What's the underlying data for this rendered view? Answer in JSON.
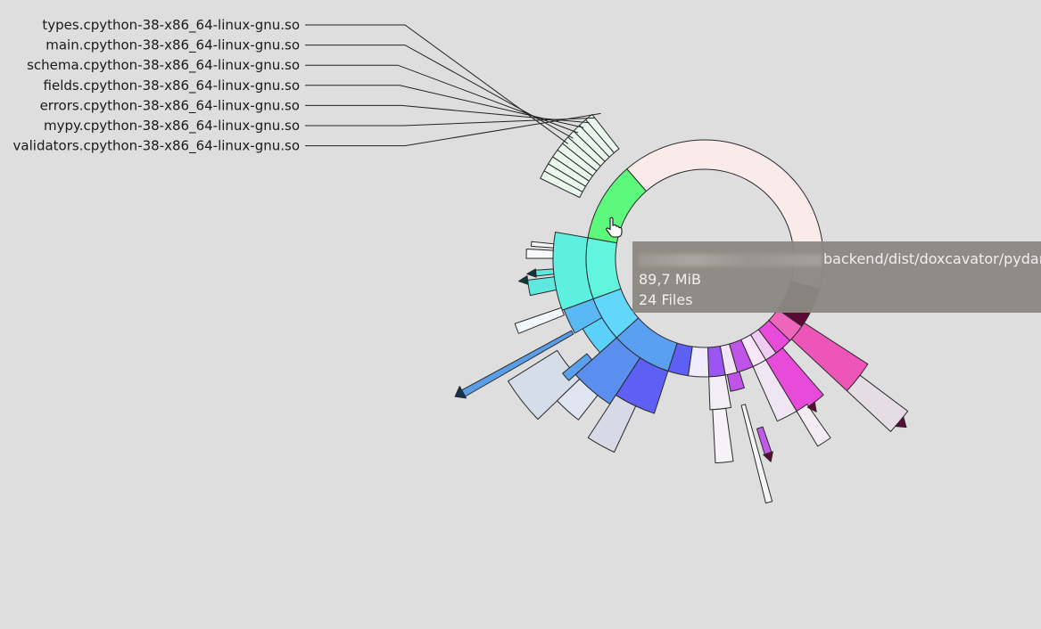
{
  "labels": [
    "types.cpython-38-x86_64-linux-gnu.so",
    "main.cpython-38-x86_64-linux-gnu.so",
    "schema.cpython-38-x86_64-linux-gnu.so",
    "fields.cpython-38-x86_64-linux-gnu.so",
    "errors.cpython-38-x86_64-linux-gnu.so",
    "mypy.cpython-38-x86_64-linux-gnu.so",
    "validators.cpython-38-x86_64-linux-gnu.so"
  ],
  "tooltip": {
    "path_visible": "backend/dist/doxcavator/pydan",
    "size": "89,7 MiB",
    "files": "24 Files"
  },
  "colors": {
    "background": "#dedede",
    "tooltip": "#8a8880",
    "root_segment": "#fbeaea",
    "highlight": "#5cf97c"
  }
}
